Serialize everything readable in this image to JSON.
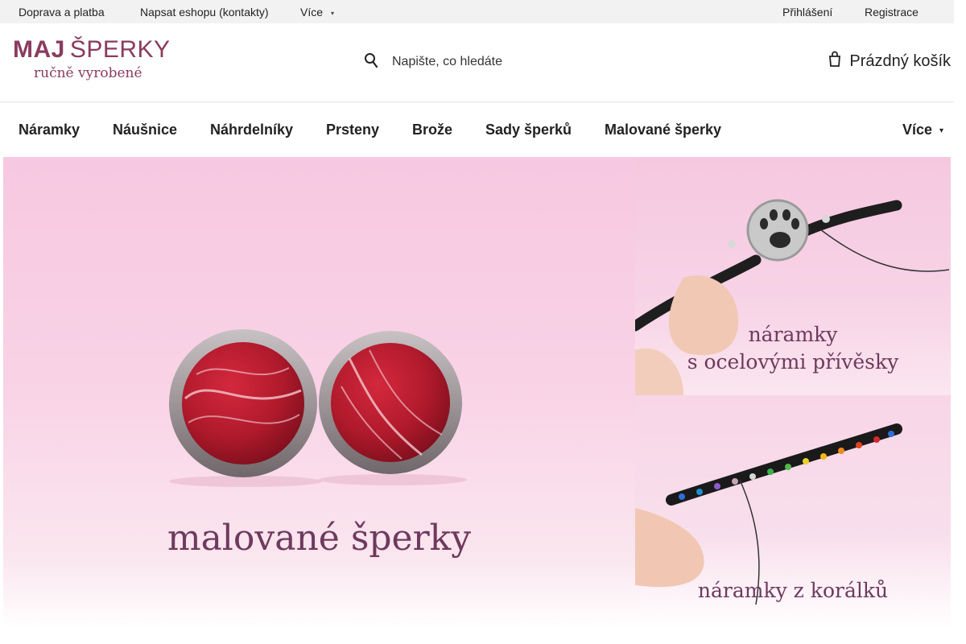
{
  "topbar": {
    "links": [
      "Doprava a platba",
      "Napsat eshopu (kontakty)"
    ],
    "more_label": "Více",
    "login": "Přihlášení",
    "register": "Registrace"
  },
  "header": {
    "logo_line1_bold": "MAJ",
    "logo_line1_rest": "ŠPERKY",
    "logo_line2": "ručně vyrobené",
    "search_placeholder": "Napište, co hledáte",
    "cart_label": "Prázdný košík"
  },
  "nav": {
    "items": [
      "Náramky",
      "Náušnice",
      "Náhrdelníky",
      "Prsteny",
      "Brože",
      "Sady šperků",
      "Malované šperky"
    ],
    "more_label": "Více"
  },
  "banners": {
    "main_caption": "malované šperky",
    "side1_caption_line1": "náramky",
    "side1_caption_line2": "s ocelovými přívěsky",
    "side2_caption": "náramky z korálků"
  },
  "colors": {
    "brand": "#8a3b5e",
    "banner_pink": "#f7c8e1",
    "topbar_bg": "#f2f2f2"
  },
  "icons": [
    "search-icon",
    "cart-icon",
    "chevron-down-icon"
  ]
}
